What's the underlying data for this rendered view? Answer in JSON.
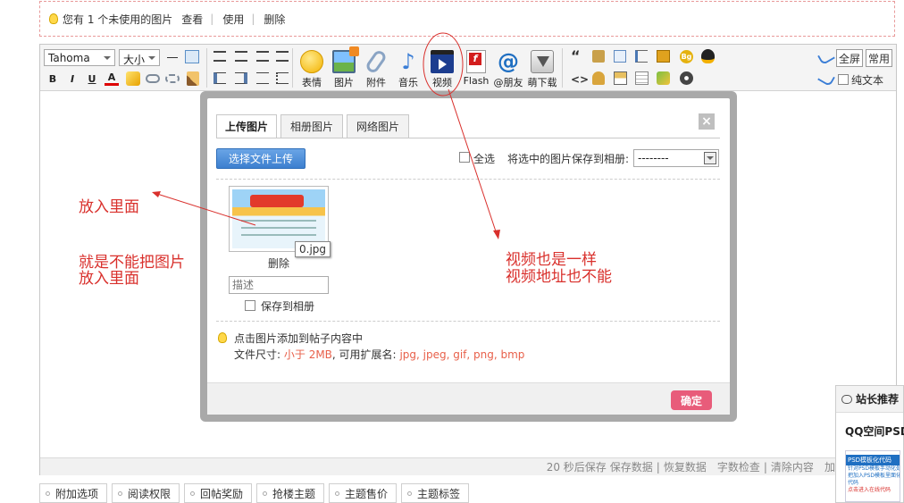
{
  "notice": {
    "text": "您有 1 个未使用的图片",
    "view": "查看",
    "use": "使用",
    "delete": "删除"
  },
  "toolbar": {
    "font_family": "Tahoma",
    "font_size": "大小",
    "format_buttons": [
      "B",
      "I",
      "U",
      "A"
    ],
    "emoji": "表情",
    "image": "图片",
    "attachment": "附件",
    "music": "音乐",
    "video": "视频",
    "flash": "Flash",
    "mention": "@朋友",
    "download": "萌下载",
    "fullscreen": "全屏",
    "normal": "常用",
    "plaintext": "纯文本"
  },
  "statusbar": {
    "autosave": "20 秒后保存",
    "save": "保存数据",
    "restore": "恢复数据",
    "wordcheck": "字数检查",
    "clear": "清除内容",
    "enlarge": "加大编辑框"
  },
  "bottom_tabs": [
    "附加选项",
    "阅读权限",
    "回帖奖励",
    "抢楼主题",
    "主题售价",
    "主题标签"
  ],
  "modal": {
    "tabs": [
      "上传图片",
      "相册图片",
      "网络图片"
    ],
    "close": "×",
    "upload_button": "选择文件上传",
    "select_all": "全选",
    "save_to_album_label": "将选中的图片保存到相册:",
    "album_select": "--------",
    "file_name": "0.jpg",
    "delete": "删除",
    "description_placeholder": "描述",
    "save_to_album": "保存到相册",
    "tip": "点击图片添加到帖子内容中",
    "file_size_label": "文件尺寸:",
    "file_size_value": "小于 2MB",
    "ext_label": ", 可用扩展名:",
    "ext_value": "jpg, jpeg, gif, png, bmp",
    "ok": "确定"
  },
  "annotations": {
    "put_inside": "放入里面",
    "cannot_line1": "就是不能把图片",
    "cannot_line2": "放入里面",
    "video_line1": "视频也是一样",
    "video_line2": "视频地址也不能"
  },
  "widget": {
    "head": "站长推荐",
    "title": "QQ空间PSD",
    "ad_bar": "PSD模板化代码",
    "ad_lines": [
      "针对PSD模板手动化处",
      "把加入PSD模板里面化",
      "代码",
      "点击进入在线代码"
    ]
  },
  "colors": {
    "annotation_red": "#d9302c",
    "upload_blue": "#3c7fcf",
    "ok_pink": "#e85c7a",
    "hint_red": "#e8604a",
    "notice_border": "#e89a9a"
  }
}
